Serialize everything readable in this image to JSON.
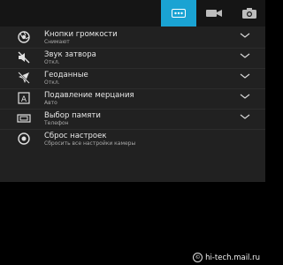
{
  "tabs": [
    {
      "name": "settings-tab",
      "icon": "more-dots-icon",
      "active": true
    },
    {
      "name": "video-tab",
      "icon": "video-camera-icon",
      "active": false
    },
    {
      "name": "photo-tab",
      "icon": "photo-camera-icon",
      "active": false
    }
  ],
  "settings": [
    {
      "title": "Кнопки громкости",
      "subtitle": "Снимают",
      "icon": "camera-aperture-icon"
    },
    {
      "title": "Звук затвора",
      "subtitle": "Откл.",
      "icon": "sound-off-icon"
    },
    {
      "title": "Геоданные",
      "subtitle": "Откл.",
      "icon": "location-off-icon"
    },
    {
      "title": "Подавление мерцания",
      "subtitle": "Авто",
      "icon": "flicker-icon"
    },
    {
      "title": "Выбор памяти",
      "subtitle": "Телефон",
      "icon": "storage-icon"
    },
    {
      "title": "Сброс настроек",
      "subtitle": "Сбросить все настройки камеры",
      "icon": "reset-icon"
    }
  ],
  "watermark": {
    "text": "hi-tech.mail.ru",
    "symbol": "©"
  },
  "colors": {
    "accent": "#1aa3d3",
    "panel": "#212121",
    "background": "#000000"
  }
}
